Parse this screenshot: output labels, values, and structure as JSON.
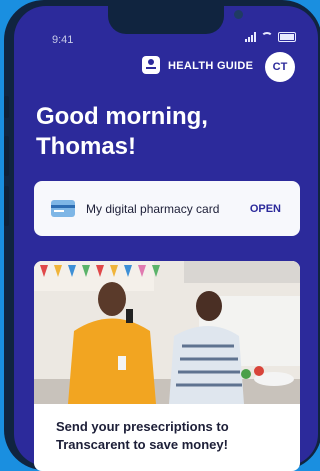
{
  "status_bar": {
    "time": "9:41"
  },
  "header": {
    "health_guide_label": "HEALTH GUIDE",
    "avatar_initials": "CT"
  },
  "greeting": "Good morning, Thomas!",
  "pharmacy_card": {
    "label": "My digital pharmacy card",
    "action": "OPEN"
  },
  "promo": {
    "text": "Send your presecriptions to Transcarent to save money!"
  },
  "colors": {
    "header_bg": "#2c2a9b",
    "accent": "#2c2a9b",
    "page_bg": "#1a8fe0"
  },
  "icons": [
    "signal-icon",
    "wifi-icon",
    "battery-icon",
    "health-guide-icon",
    "pharmacy-card-icon"
  ]
}
